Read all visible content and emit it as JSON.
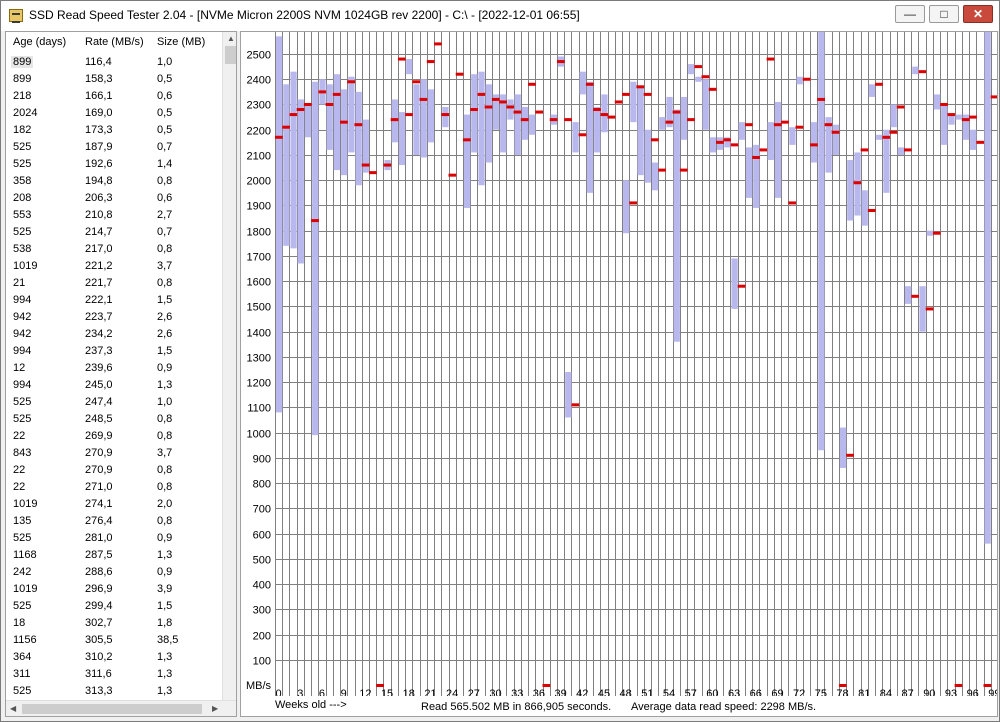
{
  "window": {
    "title": "SSD Read Speed Tester 2.04 - [NVMe Micron 2200S NVM 1024GB rev 2200] - C:\\ - [2022-12-01 06:55]",
    "minimize_glyph": "—",
    "maximize_glyph": "□",
    "close_glyph": "✕"
  },
  "list": {
    "columns": [
      "Age (days)",
      "Rate (MB/s)",
      "Size (MB)"
    ],
    "rows": [
      [
        "899",
        "116,4",
        "1,0"
      ],
      [
        "899",
        "158,3",
        "0,5"
      ],
      [
        "218",
        "166,1",
        "0,6"
      ],
      [
        "2024",
        "169,0",
        "0,5"
      ],
      [
        "182",
        "173,3",
        "0,5"
      ],
      [
        "525",
        "187,9",
        "0,7"
      ],
      [
        "525",
        "192,6",
        "1,4"
      ],
      [
        "358",
        "194,8",
        "0,8"
      ],
      [
        "208",
        "206,3",
        "0,6"
      ],
      [
        "553",
        "210,8",
        "2,7"
      ],
      [
        "525",
        "214,7",
        "0,7"
      ],
      [
        "538",
        "217,0",
        "0,8"
      ],
      [
        "1019",
        "221,2",
        "3,7"
      ],
      [
        "21",
        "221,7",
        "0,8"
      ],
      [
        "994",
        "222,1",
        "1,5"
      ],
      [
        "942",
        "223,7",
        "2,6"
      ],
      [
        "942",
        "234,2",
        "2,6"
      ],
      [
        "994",
        "237,3",
        "1,5"
      ],
      [
        "12",
        "239,6",
        "0,9"
      ],
      [
        "994",
        "245,0",
        "1,3"
      ],
      [
        "525",
        "247,4",
        "1,0"
      ],
      [
        "525",
        "248,5",
        "0,8"
      ],
      [
        "22",
        "269,9",
        "0,8"
      ],
      [
        "843",
        "270,9",
        "3,7"
      ],
      [
        "22",
        "270,9",
        "0,8"
      ],
      [
        "22",
        "271,0",
        "0,8"
      ],
      [
        "1019",
        "274,1",
        "2,0"
      ],
      [
        "135",
        "276,4",
        "0,8"
      ],
      [
        "525",
        "281,0",
        "0,9"
      ],
      [
        "1168",
        "287,5",
        "1,3"
      ],
      [
        "242",
        "288,6",
        "0,9"
      ],
      [
        "1019",
        "296,9",
        "3,9"
      ],
      [
        "525",
        "299,4",
        "1,5"
      ],
      [
        "18",
        "302,7",
        "1,8"
      ],
      [
        "1156",
        "305,5",
        "38,5"
      ],
      [
        "364",
        "310,2",
        "1,3"
      ],
      [
        "311",
        "311,6",
        "1,3"
      ],
      [
        "525",
        "313,3",
        "1,3"
      ]
    ]
  },
  "status": {
    "weeks_label": "Weeks old --->",
    "read_summary": "Read 565.502 MB in 866,905 seconds.",
    "avg_summary": "Average data read speed: 2298 MB/s."
  },
  "chart_data": {
    "type": "bar",
    "ylabel": "MB/s",
    "xlabel": "Weeks old --->",
    "ylim": [
      0,
      2600
    ],
    "yticks": [
      100,
      200,
      300,
      400,
      500,
      600,
      700,
      800,
      900,
      1000,
      1100,
      1200,
      1300,
      1400,
      1500,
      1600,
      1700,
      1800,
      1900,
      2000,
      2100,
      2200,
      2300,
      2400,
      2500
    ],
    "xtick_labels": [
      "0",
      "3",
      "6",
      "9",
      "12",
      "15",
      "18",
      "21",
      "24",
      "27",
      "30",
      "33",
      "36",
      "39",
      "42",
      "45",
      "48",
      "51",
      "54",
      "57",
      "60",
      "63",
      "66",
      "69",
      "72",
      "75",
      "78",
      "81",
      "84",
      "87",
      "90",
      "93",
      "96",
      "99"
    ],
    "grid": true,
    "colors": {
      "range": "#b8b8ee",
      "average": "#dd0000",
      "grid": "#808080"
    },
    "ranges": [
      [
        0,
        1080,
        2570
      ],
      [
        1,
        1740,
        2380
      ],
      [
        2,
        1730,
        2430
      ],
      [
        3,
        1670,
        2320
      ],
      [
        4,
        2170,
        2300
      ],
      [
        5,
        990,
        2390
      ],
      [
        6,
        2300,
        2400
      ],
      [
        7,
        2120,
        2380
      ],
      [
        8,
        2040,
        2420
      ],
      [
        9,
        2020,
        2360
      ],
      [
        10,
        2110,
        2410
      ],
      [
        11,
        1980,
        2350
      ],
      [
        12,
        2030,
        2240
      ],
      [
        15,
        2040,
        2080
      ],
      [
        16,
        2150,
        2320
      ],
      [
        17,
        2060,
        2270
      ],
      [
        18,
        2420,
        2480
      ],
      [
        19,
        2100,
        2380
      ],
      [
        20,
        2090,
        2400
      ],
      [
        21,
        2150,
        2360
      ],
      [
        23,
        2210,
        2290
      ],
      [
        26,
        1890,
        2260
      ],
      [
        27,
        2110,
        2420
      ],
      [
        28,
        1980,
        2430
      ],
      [
        29,
        2070,
        2380
      ],
      [
        30,
        2200,
        2340
      ],
      [
        31,
        2110,
        2340
      ],
      [
        32,
        2240,
        2320
      ],
      [
        33,
        2100,
        2340
      ],
      [
        34,
        2160,
        2290
      ],
      [
        35,
        2180,
        2260
      ],
      [
        38,
        2220,
        2260
      ],
      [
        39,
        2450,
        2490
      ],
      [
        40,
        1060,
        1240
      ],
      [
        41,
        2110,
        2230
      ],
      [
        42,
        2340,
        2430
      ],
      [
        43,
        1950,
        2390
      ],
      [
        44,
        2110,
        2290
      ],
      [
        45,
        2190,
        2340
      ],
      [
        48,
        1790,
        2000
      ],
      [
        49,
        2230,
        2390
      ],
      [
        50,
        2020,
        2370
      ],
      [
        51,
        1990,
        2200
      ],
      [
        52,
        1960,
        2070
      ],
      [
        53,
        2200,
        2250
      ],
      [
        54,
        2210,
        2330
      ],
      [
        55,
        1360,
        2280
      ],
      [
        56,
        2160,
        2330
      ],
      [
        57,
        2420,
        2460
      ],
      [
        58,
        2390,
        2410
      ],
      [
        59,
        2200,
        2400
      ],
      [
        60,
        2110,
        2170
      ],
      [
        61,
        2120,
        2170
      ],
      [
        62,
        2130,
        2170
      ],
      [
        63,
        1490,
        1690
      ],
      [
        64,
        2160,
        2230
      ],
      [
        65,
        1930,
        2130
      ],
      [
        66,
        1890,
        2140
      ],
      [
        68,
        2080,
        2230
      ],
      [
        69,
        1930,
        2310
      ],
      [
        71,
        2140,
        2210
      ],
      [
        72,
        2380,
        2410
      ],
      [
        74,
        2070,
        2230
      ],
      [
        75,
        930,
        2590
      ],
      [
        76,
        2030,
        2250
      ],
      [
        77,
        2100,
        2220
      ],
      [
        78,
        860,
        1020
      ],
      [
        79,
        1840,
        2080
      ],
      [
        80,
        1860,
        2110
      ],
      [
        81,
        1820,
        1960
      ],
      [
        82,
        2330,
        2380
      ],
      [
        83,
        2160,
        2180
      ],
      [
        84,
        1950,
        2200
      ],
      [
        85,
        2210,
        2300
      ],
      [
        86,
        2100,
        2130
      ],
      [
        87,
        1510,
        1580
      ],
      [
        88,
        2420,
        2450
      ],
      [
        89,
        1400,
        1580
      ],
      [
        90,
        1780,
        1800
      ],
      [
        91,
        2280,
        2340
      ],
      [
        92,
        2140,
        2300
      ],
      [
        93,
        2220,
        2260
      ],
      [
        94,
        2240,
        2260
      ],
      [
        95,
        2160,
        2260
      ],
      [
        96,
        2120,
        2200
      ],
      [
        98,
        560,
        2600
      ]
    ],
    "averages": [
      [
        0,
        2170
      ],
      [
        1,
        2210
      ],
      [
        2,
        2260
      ],
      [
        3,
        2280
      ],
      [
        4,
        2300
      ],
      [
        5,
        1840
      ],
      [
        6,
        2350
      ],
      [
        7,
        2300
      ],
      [
        8,
        2340
      ],
      [
        9,
        2230
      ],
      [
        10,
        2390
      ],
      [
        11,
        2220
      ],
      [
        12,
        2060
      ],
      [
        13,
        2030
      ],
      [
        14,
        0
      ],
      [
        15,
        2060
      ],
      [
        16,
        2240
      ],
      [
        17,
        2480
      ],
      [
        18,
        2260
      ],
      [
        19,
        2390
      ],
      [
        20,
        2320
      ],
      [
        21,
        2470
      ],
      [
        22,
        2540
      ],
      [
        23,
        2260
      ],
      [
        24,
        2020
      ],
      [
        25,
        2420
      ],
      [
        26,
        2160
      ],
      [
        27,
        2280
      ],
      [
        28,
        2340
      ],
      [
        29,
        2290
      ],
      [
        30,
        2320
      ],
      [
        31,
        2310
      ],
      [
        32,
        2290
      ],
      [
        33,
        2270
      ],
      [
        34,
        2240
      ],
      [
        35,
        2380
      ],
      [
        36,
        2270
      ],
      [
        37,
        0
      ],
      [
        38,
        2240
      ],
      [
        39,
        2470
      ],
      [
        40,
        2240
      ],
      [
        41,
        1110
      ],
      [
        42,
        2180
      ],
      [
        43,
        2380
      ],
      [
        44,
        2280
      ],
      [
        45,
        2260
      ],
      [
        46,
        2250
      ],
      [
        47,
        2310
      ],
      [
        48,
        2340
      ],
      [
        49,
        1910
      ],
      [
        50,
        2370
      ],
      [
        51,
        2340
      ],
      [
        52,
        2160
      ],
      [
        53,
        2040
      ],
      [
        54,
        2230
      ],
      [
        55,
        2270
      ],
      [
        56,
        2040
      ],
      [
        57,
        2240
      ],
      [
        58,
        2450
      ],
      [
        59,
        2410
      ],
      [
        60,
        2360
      ],
      [
        61,
        2150
      ],
      [
        62,
        2160
      ],
      [
        63,
        2140
      ],
      [
        64,
        1580
      ],
      [
        65,
        2220
      ],
      [
        66,
        2090
      ],
      [
        67,
        2120
      ],
      [
        68,
        2480
      ],
      [
        69,
        2220
      ],
      [
        70,
        2230
      ],
      [
        71,
        1910
      ],
      [
        72,
        2210
      ],
      [
        73,
        2400
      ],
      [
        74,
        2140
      ],
      [
        75,
        2320
      ],
      [
        76,
        2220
      ],
      [
        77,
        2190
      ],
      [
        78,
        0
      ],
      [
        79,
        910
      ],
      [
        80,
        1990
      ],
      [
        81,
        2120
      ],
      [
        82,
        1880
      ],
      [
        83,
        2380
      ],
      [
        84,
        2170
      ],
      [
        85,
        2190
      ],
      [
        86,
        2290
      ],
      [
        87,
        2120
      ],
      [
        88,
        1540
      ],
      [
        89,
        2430
      ],
      [
        90,
        1490
      ],
      [
        91,
        1790
      ],
      [
        92,
        2300
      ],
      [
        93,
        2260
      ],
      [
        94,
        0
      ],
      [
        95,
        2240
      ],
      [
        96,
        2250
      ],
      [
        97,
        2150
      ],
      [
        98,
        0
      ],
      [
        99,
        2330
      ]
    ]
  }
}
